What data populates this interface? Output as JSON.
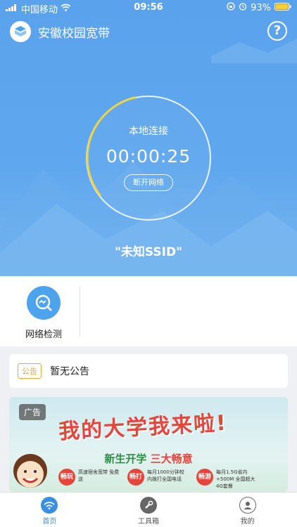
{
  "status_bar": {
    "carrier": "中国移动",
    "time": "09:56",
    "battery": "93%"
  },
  "header": {
    "title": "安徽校园宽带",
    "help_icon_text": "?"
  },
  "connection": {
    "mode": "本地连接",
    "timer": "00:00:25",
    "disconnect_label": "断开网络",
    "ssid": "\"未知SSID\""
  },
  "tools": [
    {
      "label": "网络检测",
      "icon": "network-check-icon"
    }
  ],
  "notice": {
    "badge": "公告",
    "text": "暂无公告"
  },
  "ad": {
    "tag": "广告",
    "title": "我的大学我来啦!",
    "subtitle_prefix": "新生开学",
    "subtitle_highlight": "三大畅意",
    "offers": [
      {
        "badge": "畅玩",
        "text": "高速宿舍宽带 免费送"
      },
      {
        "badge": "畅打",
        "text": "每月1000分钟校 内拨打全国电话"
      },
      {
        "badge": "畅游",
        "text": "每月1.5G省内+500M 全国超大4G套餐"
      }
    ]
  },
  "tabbar": [
    {
      "label": "首页",
      "active": true
    },
    {
      "label": "工具箱",
      "active": false
    },
    {
      "label": "我的",
      "active": false
    }
  ],
  "colors": {
    "primary": "#5aa2eb",
    "accent_orange": "#f0a43a",
    "ad_red": "#e5453a",
    "tab_active": "#3a8fe0"
  }
}
